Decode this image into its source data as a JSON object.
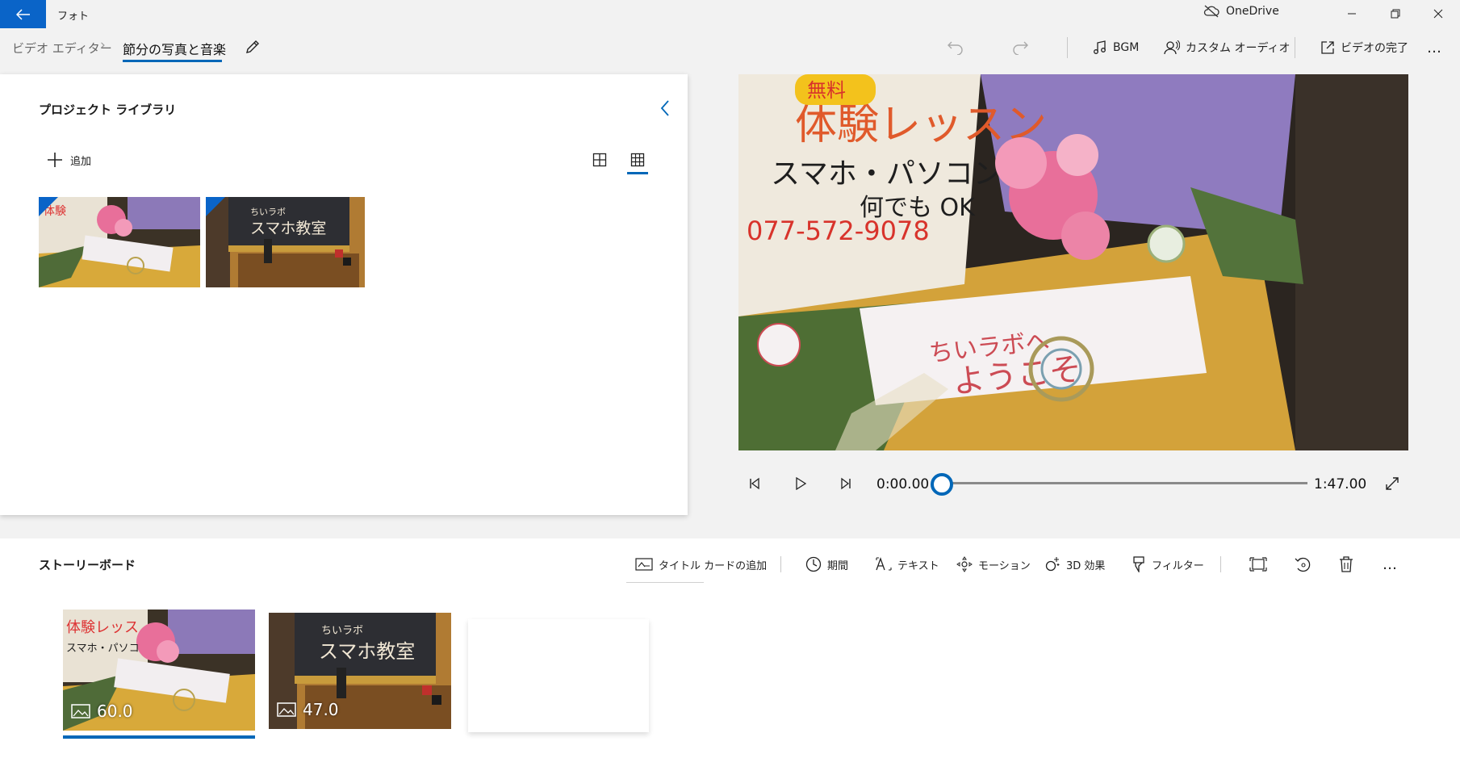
{
  "app": {
    "title": "フォト",
    "onedrive_label": "OneDrive"
  },
  "toolbar": {
    "breadcrumb_root": "ビデオ エディター",
    "breadcrumb_separator": "›",
    "project_name": "節分の写真と音楽",
    "bgm_label": "BGM",
    "custom_audio_label": "カスタム オーディオ",
    "finish_video_label": "ビデオの完了",
    "more_label": "…"
  },
  "library": {
    "title": "プロジェクト ライブラリ",
    "add_label": "追加",
    "thumbnails": [
      {
        "name": "flower-sign-photo"
      },
      {
        "name": "smartphone-class-sign-photo"
      }
    ]
  },
  "player": {
    "current_time": "0:00.00",
    "total_time": "1:47.00",
    "progress": 0.0
  },
  "storyboard": {
    "title": "ストーリーボード",
    "add_title_card_label": "タイトル カードの追加",
    "duration_label": "期間",
    "text_label": "テキスト",
    "motion_label": "モーション",
    "effects_3d_label": "3D 効果",
    "filters_label": "フィルター",
    "more_label": "…",
    "clips": [
      {
        "duration": "60.0",
        "selected": true
      },
      {
        "duration": "47.0",
        "selected": false
      }
    ]
  },
  "colors": {
    "accent": "#0067b8",
    "back_button": "#0a64c8",
    "background": "#f2f2f2"
  }
}
